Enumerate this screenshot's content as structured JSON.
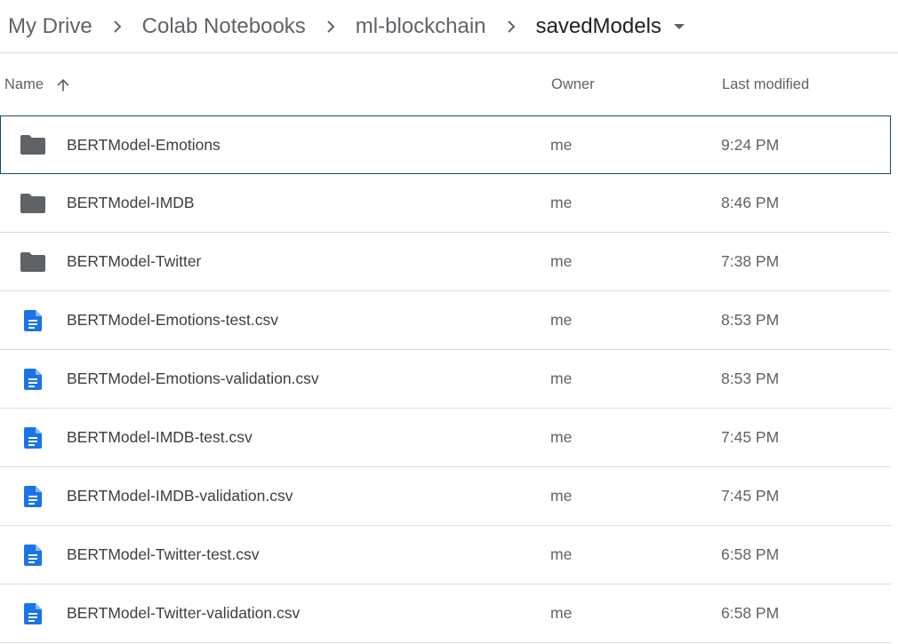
{
  "breadcrumb": {
    "items": [
      {
        "label": "My Drive"
      },
      {
        "label": "Colab Notebooks"
      },
      {
        "label": "ml-blockchain"
      },
      {
        "label": "savedModels"
      }
    ],
    "separator_icon": "chevron-right-icon",
    "dropdown_icon": "caret-down-icon"
  },
  "columns": {
    "name": "Name",
    "owner": "Owner",
    "last_modified": "Last modified",
    "sort_icon": "arrow-up-icon"
  },
  "colors": {
    "folder_icon": "#5f6368",
    "doc_icon": "#1a73e8",
    "selected_border": "#184c6e",
    "divider": "#dadce0"
  },
  "files": [
    {
      "name": "BERTModel-Emotions",
      "type": "folder",
      "owner": "me",
      "modified": "9:24 PM",
      "selected": true
    },
    {
      "name": "BERTModel-IMDB",
      "type": "folder",
      "owner": "me",
      "modified": "8:46 PM",
      "selected": false
    },
    {
      "name": "BERTModel-Twitter",
      "type": "folder",
      "owner": "me",
      "modified": "7:38 PM",
      "selected": false
    },
    {
      "name": "BERTModel-Emotions-test.csv",
      "type": "document",
      "owner": "me",
      "modified": "8:53 PM",
      "selected": false
    },
    {
      "name": "BERTModel-Emotions-validation.csv",
      "type": "document",
      "owner": "me",
      "modified": "8:53 PM",
      "selected": false
    },
    {
      "name": "BERTModel-IMDB-test.csv",
      "type": "document",
      "owner": "me",
      "modified": "7:45 PM",
      "selected": false
    },
    {
      "name": "BERTModel-IMDB-validation.csv",
      "type": "document",
      "owner": "me",
      "modified": "7:45 PM",
      "selected": false
    },
    {
      "name": "BERTModel-Twitter-test.csv",
      "type": "document",
      "owner": "me",
      "modified": "6:58 PM",
      "selected": false
    },
    {
      "name": "BERTModel-Twitter-validation.csv",
      "type": "document",
      "owner": "me",
      "modified": "6:58 PM",
      "selected": false
    }
  ]
}
